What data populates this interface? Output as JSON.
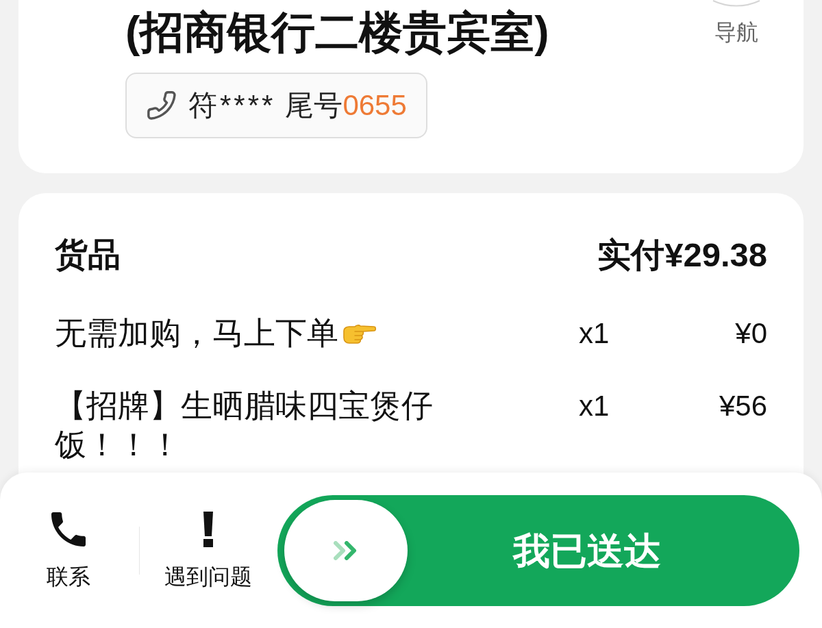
{
  "address_card": {
    "address": "(招商银行二楼贵宾室)",
    "phone": {
      "masked_name": "符****",
      "tail_label": "尾号",
      "tail_digits": "0655"
    },
    "navigation": {
      "label": "导航"
    }
  },
  "goods_card": {
    "title": "货品",
    "paid_total": "实付¥29.38",
    "items": [
      {
        "name": "无需加购，马上下单",
        "pointer_emoji": true,
        "quantity": "x1",
        "price": "¥0"
      },
      {
        "name": "【招牌】生晒腊味四宝煲仔饭！！！",
        "pointer_emoji": false,
        "quantity": "x1",
        "price": "¥56"
      }
    ]
  },
  "bottom_bar": {
    "actions": [
      {
        "kind": "phone",
        "label": "联系"
      },
      {
        "kind": "alert",
        "label": "遇到问题"
      }
    ],
    "slider": {
      "label": "我已送达"
    }
  }
}
